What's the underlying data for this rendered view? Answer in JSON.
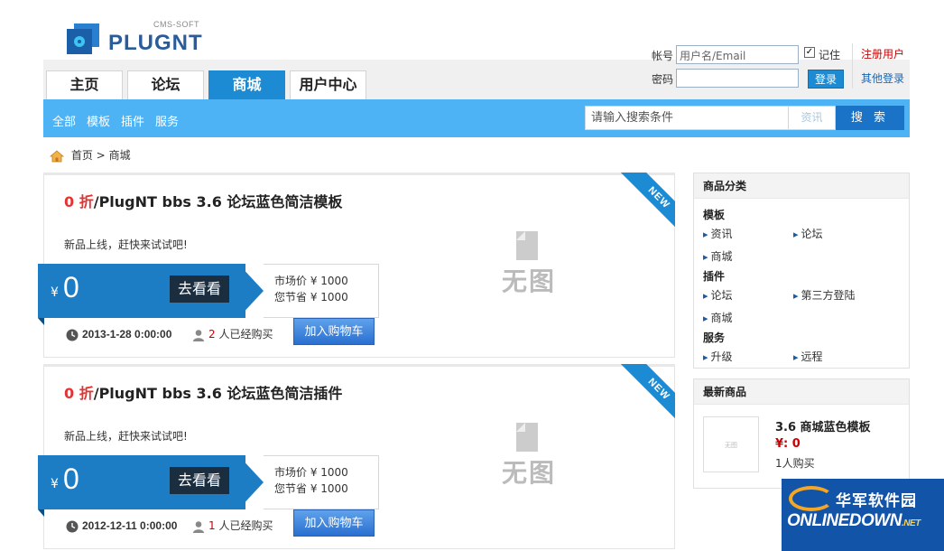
{
  "logo": {
    "cms": "CMS-SOFT",
    "name": "PLUGNT"
  },
  "tabs": [
    {
      "label": "主页",
      "active": false
    },
    {
      "label": "论坛",
      "active": false
    },
    {
      "label": "商城",
      "active": true
    },
    {
      "label": "用户中心",
      "active": false
    }
  ],
  "login": {
    "account_label": "帐号",
    "account_value": "用户名/Email",
    "password_label": "密码",
    "password_value": "",
    "remember_label": "记住",
    "remember_checked": true,
    "login_button": "登录",
    "register_link": "注册用户",
    "other_login_link": "其他登录"
  },
  "subnav": {
    "items": [
      "全部",
      "模板",
      "插件",
      "服务"
    ],
    "search_placeholder": "请输入搜索条件",
    "search_category": "资讯",
    "search_button": "搜 索"
  },
  "breadcrumb": {
    "home": "首页",
    "sep": ">",
    "current": "商城"
  },
  "products": [
    {
      "discount": "0 折",
      "name": "/PlugNT bbs 3.6 论坛蓝色简洁模板",
      "desc": "新品上线，赶快来试试吧!",
      "badge": "NEW",
      "noimg": "无图",
      "currency": "¥",
      "price": "0",
      "go_button": "去看看",
      "market_price": "市场价 ¥ 1000",
      "saved": "您节省 ¥ 1000",
      "date": "2013-1-28 0:00:00",
      "buyers_count": "2",
      "buyers_text": " 人已经购买",
      "cart_button": "加入购物车"
    },
    {
      "discount": "0 折",
      "name": "/PlugNT bbs 3.6 论坛蓝色简洁插件",
      "desc": "新品上线，赶快来试试吧!",
      "badge": "NEW",
      "noimg": "无图",
      "currency": "¥",
      "price": "0",
      "go_button": "去看看",
      "market_price": "市场价 ¥ 1000",
      "saved": "您节省 ¥ 1000",
      "date": "2012-12-11 0:00:00",
      "buyers_count": "1",
      "buyers_text": " 人已经购买",
      "cart_button": "加入购物车"
    }
  ],
  "sidebar": {
    "categories": {
      "title": "商品分类",
      "groups": [
        {
          "name": "模板",
          "links": [
            "资讯",
            "论坛",
            "商城"
          ]
        },
        {
          "name": "插件",
          "links": [
            "论坛",
            "第三方登陆",
            "商城"
          ]
        },
        {
          "name": "服务",
          "links": [
            "升级",
            "远程"
          ]
        }
      ]
    },
    "latest": {
      "title": "最新商品",
      "thumb_text": "无图",
      "item_title": "3.6 商城蓝色模板",
      "item_price": "¥: 0",
      "item_buyers": "1人购买"
    }
  },
  "watermark": {
    "cn": "华军软件园",
    "en": "ONLINEDOWN",
    "net": ".NET"
  },
  "colors": {
    "accent": "#1c8bd4",
    "subnav": "#4db3f5",
    "discount": "#e53333"
  }
}
